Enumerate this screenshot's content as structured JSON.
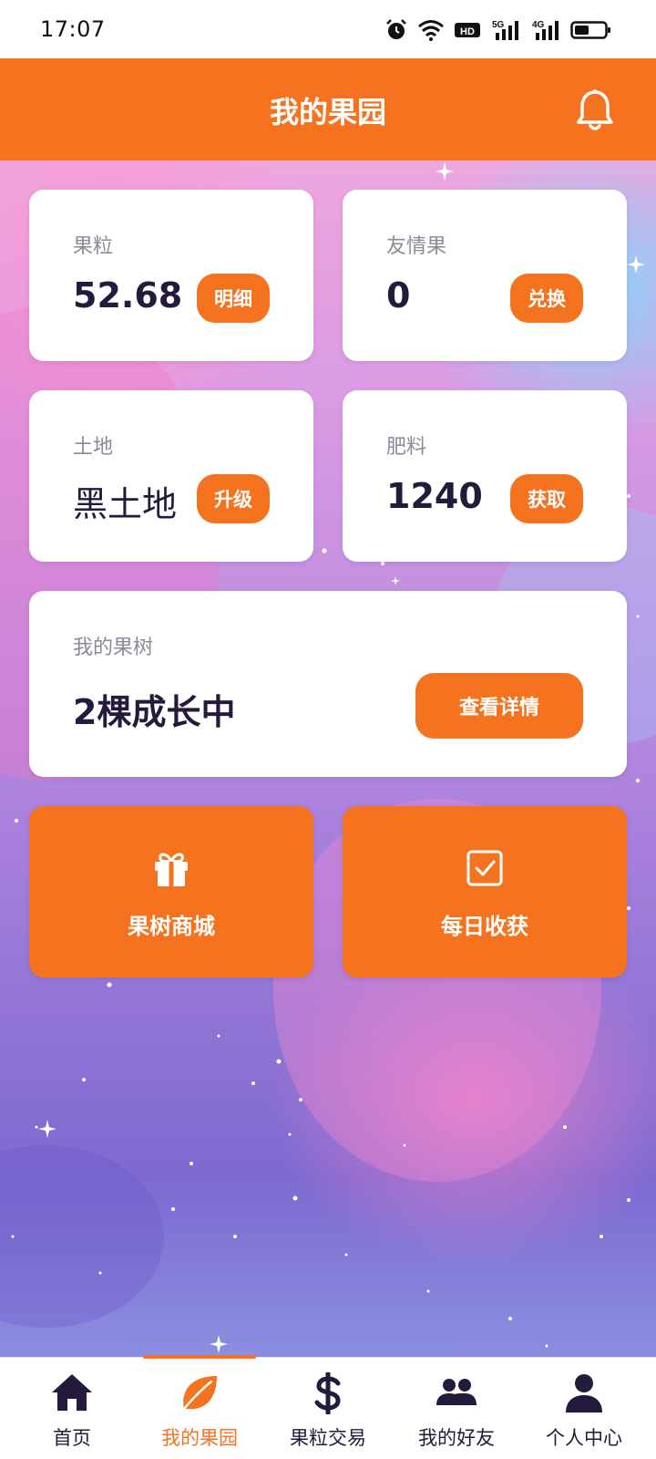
{
  "status_bar": {
    "time": "17:07",
    "icons": [
      "alarm-icon",
      "wifi-icon",
      "hd-icon",
      "signal-5g-icon",
      "signal-4g-icon",
      "battery-icon"
    ],
    "hd_label": "HD",
    "net1_label": "5G",
    "net2_label": "4G"
  },
  "header": {
    "title": "我的果园",
    "icon": "bell-icon"
  },
  "cards": {
    "fruit_grain": {
      "label": "果粒",
      "value": "52.68",
      "button": "明细"
    },
    "friendship_fruit": {
      "label": "友情果",
      "value": "0",
      "button": "兑换"
    },
    "land": {
      "label": "土地",
      "value": "黑土地",
      "button": "升级"
    },
    "fertilizer": {
      "label": "肥料",
      "value": "1240",
      "button": "获取"
    },
    "my_trees": {
      "label": "我的果树",
      "value": "2棵成长中",
      "button": "查看详情"
    }
  },
  "actions": {
    "shop": {
      "label": "果树商城",
      "icon": "gift-icon"
    },
    "daily": {
      "label": "每日收获",
      "icon": "checkbox-icon"
    }
  },
  "tabbar": {
    "active_index": 1,
    "tabs": [
      {
        "label": "首页",
        "icon": "home-icon"
      },
      {
        "label": "我的果园",
        "icon": "leaf-icon"
      },
      {
        "label": "果粒交易",
        "icon": "dollar-icon"
      },
      {
        "label": "我的好友",
        "icon": "friends-icon"
      },
      {
        "label": "个人中心",
        "icon": "person-icon"
      }
    ]
  },
  "colors": {
    "accent": "#f5731f",
    "text_dark": "#231a3c",
    "label_gray": "#8a8a99"
  }
}
